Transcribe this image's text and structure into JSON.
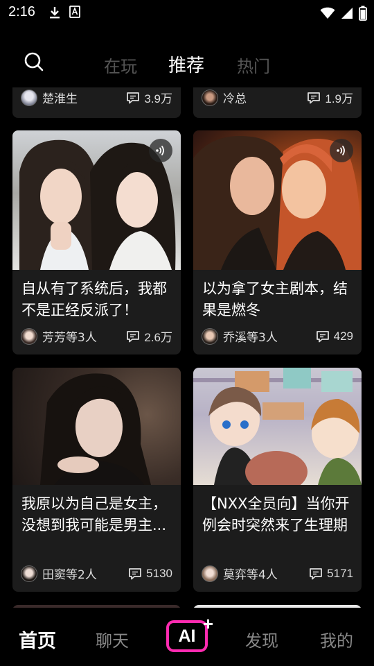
{
  "status": {
    "time": "2:16",
    "icons_left": [
      "download-icon",
      "font-a-icon"
    ],
    "icons_right": [
      "wifi-icon",
      "signal-icon",
      "battery-icon"
    ]
  },
  "tabs": [
    {
      "label": "在玩",
      "active": false
    },
    {
      "label": "推荐",
      "active": true
    },
    {
      "label": "热门",
      "active": false
    }
  ],
  "partial_cards": [
    {
      "author": "楚淮生",
      "count": "3.9万"
    },
    {
      "author": "冷总",
      "count": "1.9万"
    }
  ],
  "cards": [
    {
      "title": "自从有了系统后，我都不是正经反派了！",
      "author": "芳芳等3人",
      "count": "2.6万",
      "has_voice": true
    },
    {
      "title": "以为拿了女主剧本，结果是燃冬",
      "author": "乔溪等3人",
      "count": "429",
      "has_voice": true
    },
    {
      "title": "我原以为自己是女主，没想到我可能是男主...",
      "author": "田窦等2人",
      "count": "5130",
      "has_voice": false
    },
    {
      "title": "【NXX全员向】当你开例会时突然来了生理期",
      "author": "莫弈等4人",
      "count": "5171",
      "has_voice": false
    }
  ],
  "bottom_nav": [
    {
      "label": "首页",
      "active": true
    },
    {
      "label": "聊天",
      "active": false
    },
    {
      "label": "AI",
      "active": false
    },
    {
      "label": "发现",
      "active": false
    },
    {
      "label": "我的",
      "active": false
    }
  ],
  "colors": {
    "background": "#000000",
    "card": "#1c1c1c",
    "accent": "#ff2bb0"
  }
}
